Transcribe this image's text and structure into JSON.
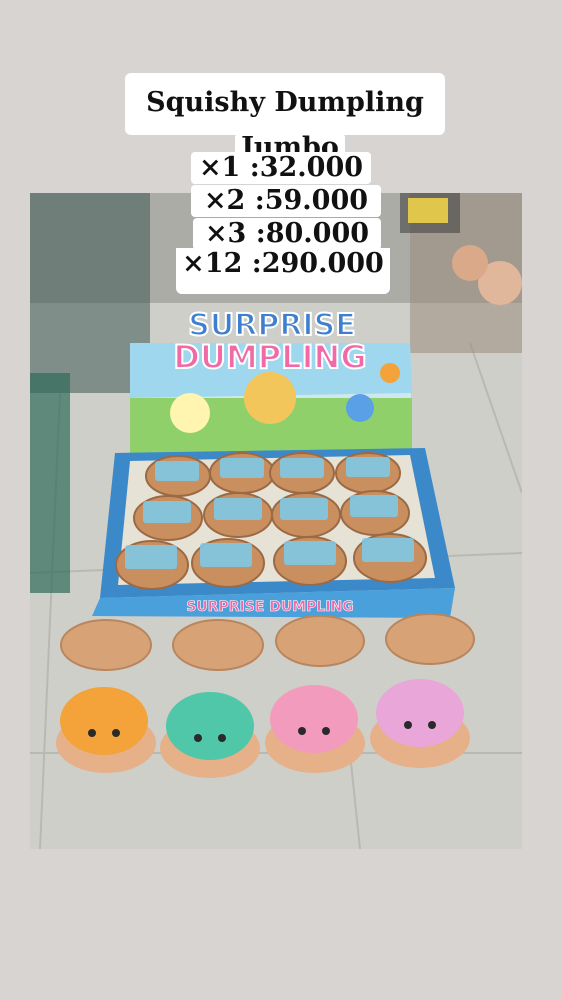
{
  "overlay": {
    "title_line1": "Squishy Dumpling",
    "title_line2": "Jumbo",
    "prices": [
      "×1 :32.000",
      "×2 :59.000",
      "×3 :80.000",
      "×12 :290.000"
    ]
  },
  "product": {
    "brand_line1": "SURPRISE",
    "brand_line2": "DUMPLING",
    "box_front_text": "SURPRISE DUMPLING",
    "colors": [
      "#f4a23a",
      "#4fc7a8",
      "#f39bbd",
      "#e9a6d9"
    ]
  }
}
